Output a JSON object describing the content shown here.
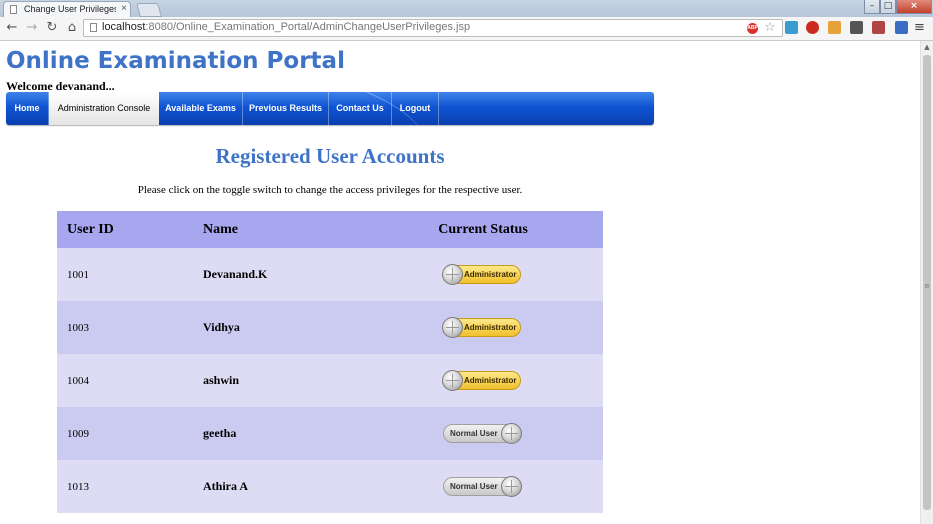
{
  "browser": {
    "tab_title": "Change User Privileges - A",
    "tab_close": "×",
    "window_controls": {
      "minimize": "–",
      "maximize": "□",
      "close": "×"
    },
    "nav": {
      "back": "←",
      "forward": "→",
      "reload": "↻",
      "home": "⌂"
    },
    "url_host": "localhost",
    "url_rest": ":8080/Online_Examination_Portal/AdminChangeUserPrivileges.jsp",
    "adblock_badge": "ABP",
    "star": "☆",
    "menu": "≡",
    "extension_icons": [
      "puzzle-icon",
      "stop-icon",
      "v-icon",
      "evernote-icon",
      "download-icon",
      "translate-icon"
    ]
  },
  "scrollbar": {
    "up_arrow": "▲",
    "grip": "≡"
  },
  "site": {
    "title": "Online Examination Portal",
    "welcome": "Welcome devanand..."
  },
  "nav": {
    "items": [
      {
        "label": "Home"
      },
      {
        "label": "Administration Console",
        "active": true
      },
      {
        "label": "Available Exams"
      },
      {
        "label": "Previous Results"
      },
      {
        "label": "Contact Us"
      },
      {
        "label": "Logout"
      }
    ]
  },
  "main": {
    "heading": "Registered User Accounts",
    "instruction": "Please click on the toggle switch to change the access privileges for the respective user.",
    "columns": [
      "User ID",
      "Name",
      "Current Status"
    ],
    "rows": [
      {
        "id": "1001",
        "name": "Devanand.K",
        "status": "Administrator"
      },
      {
        "id": "1003",
        "name": "Vidhya",
        "status": "Administrator"
      },
      {
        "id": "1004",
        "name": "ashwin",
        "status": "Administrator"
      },
      {
        "id": "1009",
        "name": "geetha",
        "status": "Normal User"
      },
      {
        "id": "1013",
        "name": "Athira A",
        "status": "Normal User"
      }
    ]
  },
  "colors": {
    "title_blue": "#3e73c8",
    "nav_blue": "#1054d2",
    "header_row": "#a7a7ef",
    "row_light": "#dddcf4",
    "row_dark": "#cbcaf1",
    "admin_toggle": "#f1c02a",
    "normal_toggle": "#c8c8c8"
  }
}
